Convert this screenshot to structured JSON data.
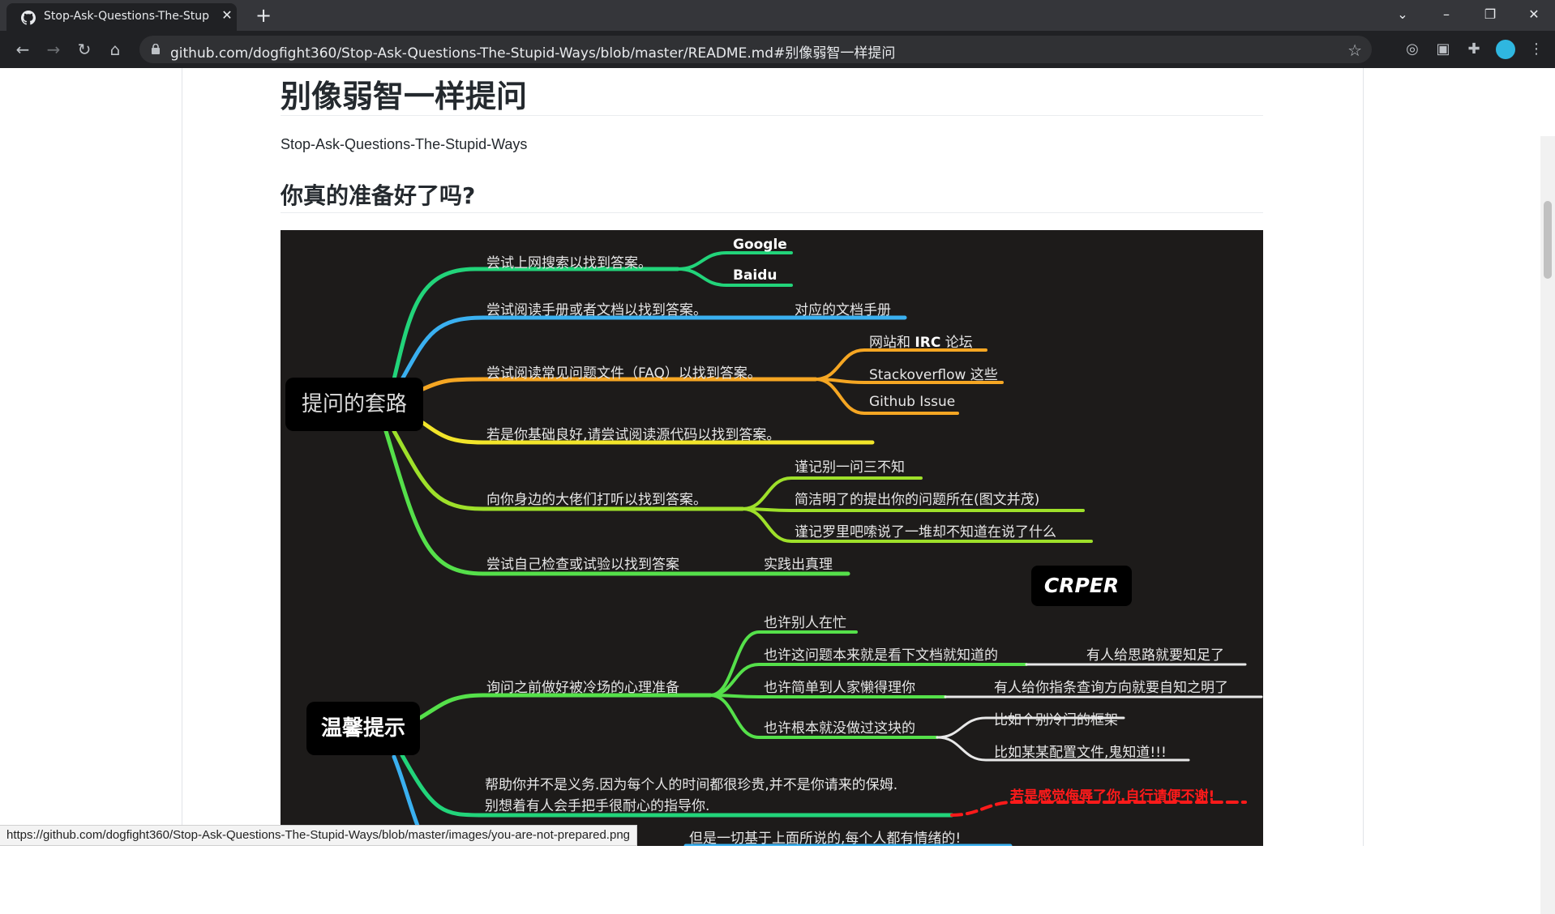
{
  "browser": {
    "tab_title": "Stop-Ask-Questions-The-Stup",
    "url": "github.com/dogfight360/Stop-Ask-Questions-The-Stupid-Ways/blob/master/README.md#别像弱智一样提问",
    "status_url": "https://github.com/dogfight360/Stop-Ask-Questions-The-Stupid-Ways/blob/master/images/you-are-not-prepared.png"
  },
  "article": {
    "h1": "别像弱智一样提问",
    "subtitle": "Stop-Ask-Questions-The-Stupid-Ways",
    "h2": "你真的准备好了吗?"
  },
  "mindmap": {
    "root1": "提问的套路",
    "root2": "温馨提示",
    "google": "Google",
    "baidu": "Baidu",
    "n1": "尝试上网搜索以找到答案。",
    "n2": "尝试阅读手册或者文档以找到答案。",
    "n2a": "对应的文档手册",
    "n3": "尝试阅读常见问题文件（FAQ）以找到答案。",
    "n3a": "网站和",
    "n3a_bold": "IRC",
    "n3a_tail": "论坛",
    "n3b": "Stackoverflow 这些",
    "n3c": "Github Issue",
    "n4": "若是你基础良好,请尝试阅读源代码以找到答案。",
    "n5": "向你身边的大佬们打听以找到答案。",
    "n5a": "谨记别一问三不知",
    "n5b": "简洁明了的提出你的问题所在(图文并茂)",
    "n5c": "谨记罗里吧嗦说了一堆却不知道在说了什么",
    "n6": "尝试自己检查或试验以找到答案",
    "n6a": "实践出真理",
    "crper": "CRPER",
    "t1": "询问之前做好被冷场的心理准备",
    "t1a": "也许别人在忙",
    "t1b": "也许这问题本来就是看下文档就知道的",
    "t1b1": "有人给思路就要知足了",
    "t1c": "也许简单到人家懒得理你",
    "t1c1": "有人给你指条查询方向就要自知之明了",
    "t1d": "也许根本就没做过这块的",
    "t1d1": "比如个别冷门的框架",
    "t1d2": "比如某某配置文件,鬼知道!!!",
    "t2_line1": "帮助你并不是义务.因为每个人的时间都很珍贵,并不是你请来的保姆.",
    "t2_line2": "别想着有人会手把手很耐心的指导你.",
    "t2_red": "若是感觉侮辱了你,自行请便不谢!",
    "t3": "但是一切基于上面所说的,每个人都有情绪的!"
  },
  "colors": {
    "green": "#22d47a",
    "blue": "#3ab0f0",
    "orange": "#f5a623",
    "yellow": "#f2e52a",
    "lime": "#9ee02a",
    "brightgreen": "#55e04a",
    "white": "#e8e8e8",
    "red": "#ff1a1a"
  }
}
